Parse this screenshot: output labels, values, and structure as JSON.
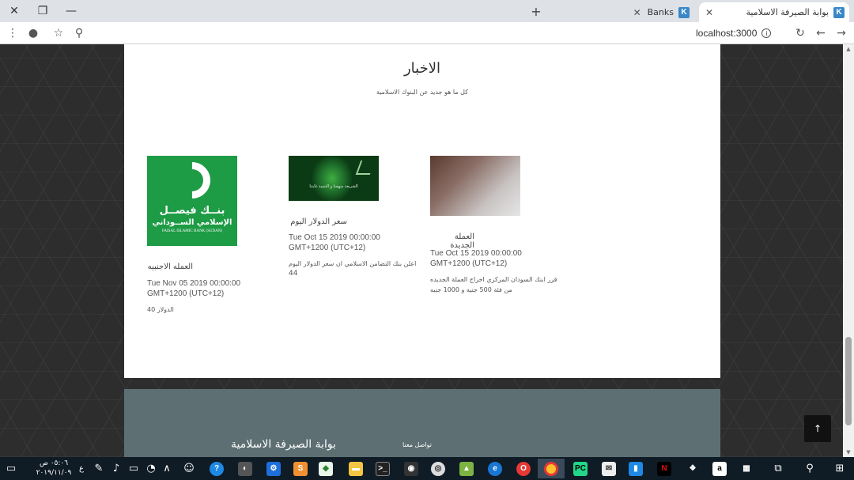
{
  "browser": {
    "tabs": [
      {
        "title": "بوابة الصيرفة الاسلامية",
        "favicon": "K",
        "active": true
      },
      {
        "title": "Banks",
        "favicon": "K",
        "active": false
      }
    ],
    "new_tab": "+",
    "url": "localhost:3000"
  },
  "news": {
    "title": "الاخبار",
    "subtitle": "كل ما هو جديد عن البنوك الاسلامية",
    "cards": [
      {
        "title": "العمله الاجنبيه",
        "date_line1": "Tue Nov 05 2019 00:00:00",
        "date_line2": "GMT+1200 (UTC+12)",
        "body_line1": "الدولار 40",
        "body_line2": "",
        "logo": {
          "line1": "بنــك فيصــل",
          "line2": "الإسلامي الســوداني",
          "line3": "FAISAL ISLAMIC BANK (SUDAN)"
        }
      },
      {
        "title": "سعر الدولار اليوم",
        "date_line1": "Tue Oct 15 2019 00:00:00",
        "date_line2": "GMT+1200 (UTC+12)",
        "body_line1": "اعلن بنك التضامن الاسلامي ان سعر الدولار اليوم",
        "body_line2": "44",
        "logo": {
          "line1": "الشريعة منهجنا و التنمية غايتنا"
        }
      },
      {
        "title": "العملة الجديدة",
        "date_line1": "Tue Oct 15 2019 00:00:00",
        "date_line2": "GMT+1200 (UTC+12)",
        "body_line1": "قرر ابنك السودان المركزي اخراج العملة الجديده",
        "body_line2": "من فئة 500 جنيه و 1000 جنيه"
      }
    ]
  },
  "footer": {
    "brand": "بوابة الصيرفة الاسلامية",
    "contact": "تواصل معنا"
  },
  "back_to_top": "↑",
  "taskbar": {
    "time": "٠٥:٠٦ ص",
    "date": "٢٠١٩/١١/٠٩",
    "lang": "ع"
  }
}
